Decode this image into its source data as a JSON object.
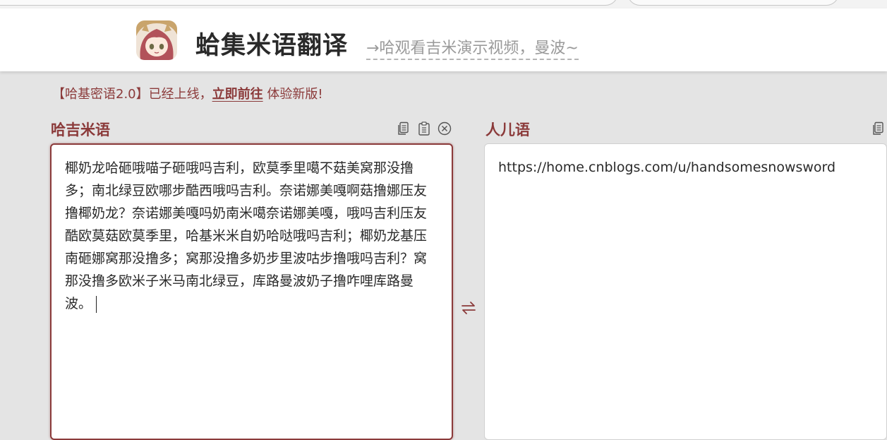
{
  "header": {
    "title": "蛤集米语翻译",
    "link_text": "→哈观看吉米演示视频，曼波~"
  },
  "notice": {
    "prefix": "【哈基密语2.0】已经上线，",
    "link": "立即前往",
    "suffix": "体验新版!"
  },
  "source_panel": {
    "label": "哈吉米语",
    "text": "椰奶龙哈砸哦喵子砸哦吗吉利，欧莫季里噶不菇美窝那没撸多；南北绿豆欧哪步酷西哦吗吉利。奈诺娜美嘎啊菇撸娜压友撸椰奶龙？奈诺娜美嘎吗奶南米噶奈诺娜美嘎，哦吗吉利压友酷欧莫菇欧莫季里，哈基米米自奶哈哒哦吗吉利；椰奶龙基压南砸娜窝那没撸多；窝那没撸多奶步里波咕步撸哦吗吉利？窝那没撸多欧米子米马南北绿豆，库路曼波奶子撸咋哩库路曼波。",
    "tools": [
      "copy-icon",
      "paste-icon",
      "clear-icon"
    ]
  },
  "target_panel": {
    "label": "人儿语",
    "text": "https://home.cnblogs.com/u/handsomesnowsword",
    "tools": [
      "copy-icon"
    ]
  },
  "colors": {
    "accent": "#8b3a3a",
    "background": "#e4e4e4",
    "panel": "#ffffff"
  }
}
